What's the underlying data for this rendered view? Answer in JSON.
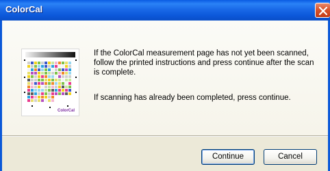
{
  "window": {
    "title": "ColorCal",
    "close_icon": "close-icon"
  },
  "content": {
    "image_icon": "colorcal-measurement-page-thumbnail",
    "image_label": "ColorCal",
    "message_1": "If the ColorCal measurement page has not yet been scanned, follow the printed instructions and press continue after the scan is complete.",
    "message_2": "If scanning has already been completed, press continue."
  },
  "buttons": {
    "continue_label": "Continue",
    "cancel_label": "Cancel"
  },
  "colors": {
    "titlebar": "#0a5be3",
    "close_button": "#d9542c",
    "dialog_bg": "#ece9d8",
    "thumbnail_logo": "#7a2aa0"
  }
}
